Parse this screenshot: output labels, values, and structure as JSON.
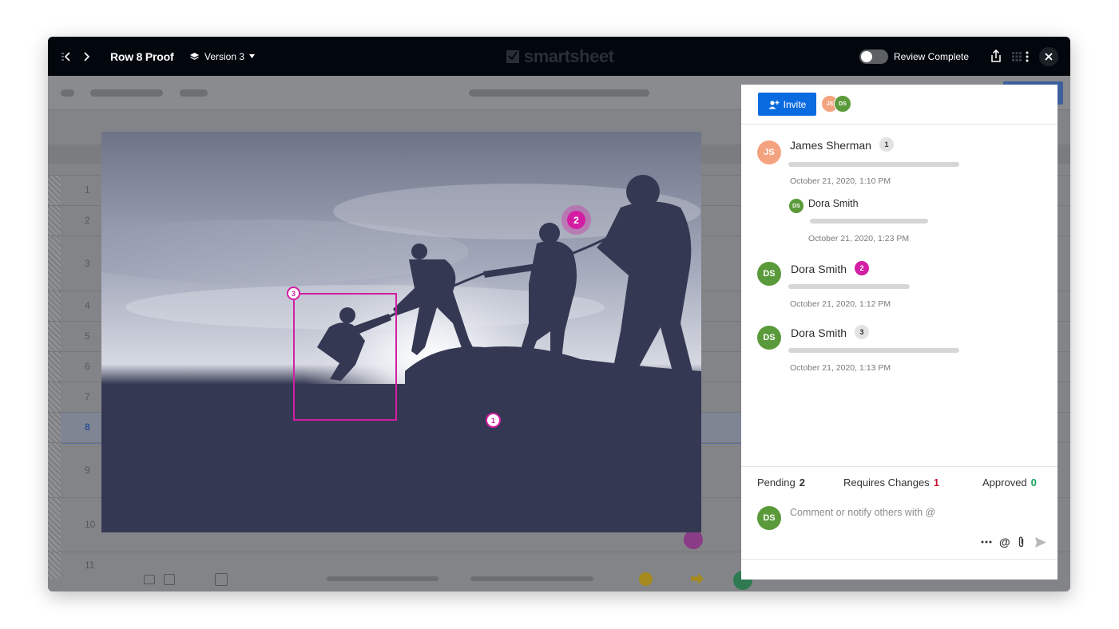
{
  "window": {
    "title": "Row 8 Proof",
    "version_label": "Version 3",
    "logo_text": "smartsheet",
    "review_toggle_label": "Review Complete",
    "review_complete": false
  },
  "sheet": {
    "row_numbers": [
      "1",
      "2",
      "3",
      "4",
      "5",
      "6",
      "7",
      "8",
      "9",
      "10",
      "11"
    ],
    "selected_row": "8"
  },
  "proof_markers": [
    {
      "number": "1",
      "type": "point",
      "color": "#d31ea4"
    },
    {
      "number": "2",
      "type": "point-active",
      "color": "#d31ea4"
    },
    {
      "number": "3",
      "type": "rectangle",
      "color": "#d31ea4"
    }
  ],
  "panel": {
    "invite_label": "Invite",
    "collaborators": [
      {
        "initials": "JS",
        "color": "#f4a380"
      },
      {
        "initials": "DS",
        "color": "#5a9a3a"
      }
    ],
    "comments": [
      {
        "initials": "JS",
        "color": "#f4a380",
        "author": "James Sherman",
        "marker": "1",
        "marker_active": false,
        "time": "October 21, 2020, 1:10 PM"
      },
      {
        "initials": "DS",
        "color": "#5a9a3a",
        "author": "Dora Smith",
        "reply": true,
        "time": "October 21, 2020, 1:23 PM"
      },
      {
        "initials": "DS",
        "color": "#5a9a3a",
        "author": "Dora Smith",
        "marker": "2",
        "marker_active": true,
        "time": "October 21, 2020, 1:12 PM"
      },
      {
        "initials": "DS",
        "color": "#5a9a3a",
        "author": "Dora Smith",
        "marker": "3",
        "marker_active": false,
        "time": "October 21, 2020, 1:13 PM"
      }
    ],
    "status": {
      "pending_label": "Pending",
      "pending_count": "2",
      "changes_label": "Requires Changes",
      "changes_count": "1",
      "approved_label": "Approved",
      "approved_count": "0"
    },
    "composer": {
      "initials": "DS",
      "placeholder": "Comment or notify others with @"
    }
  },
  "colors": {
    "accent": "#0a6be0",
    "marker": "#d31ea4",
    "requires_changes": "#c8102e",
    "approved": "#1aa35a"
  }
}
